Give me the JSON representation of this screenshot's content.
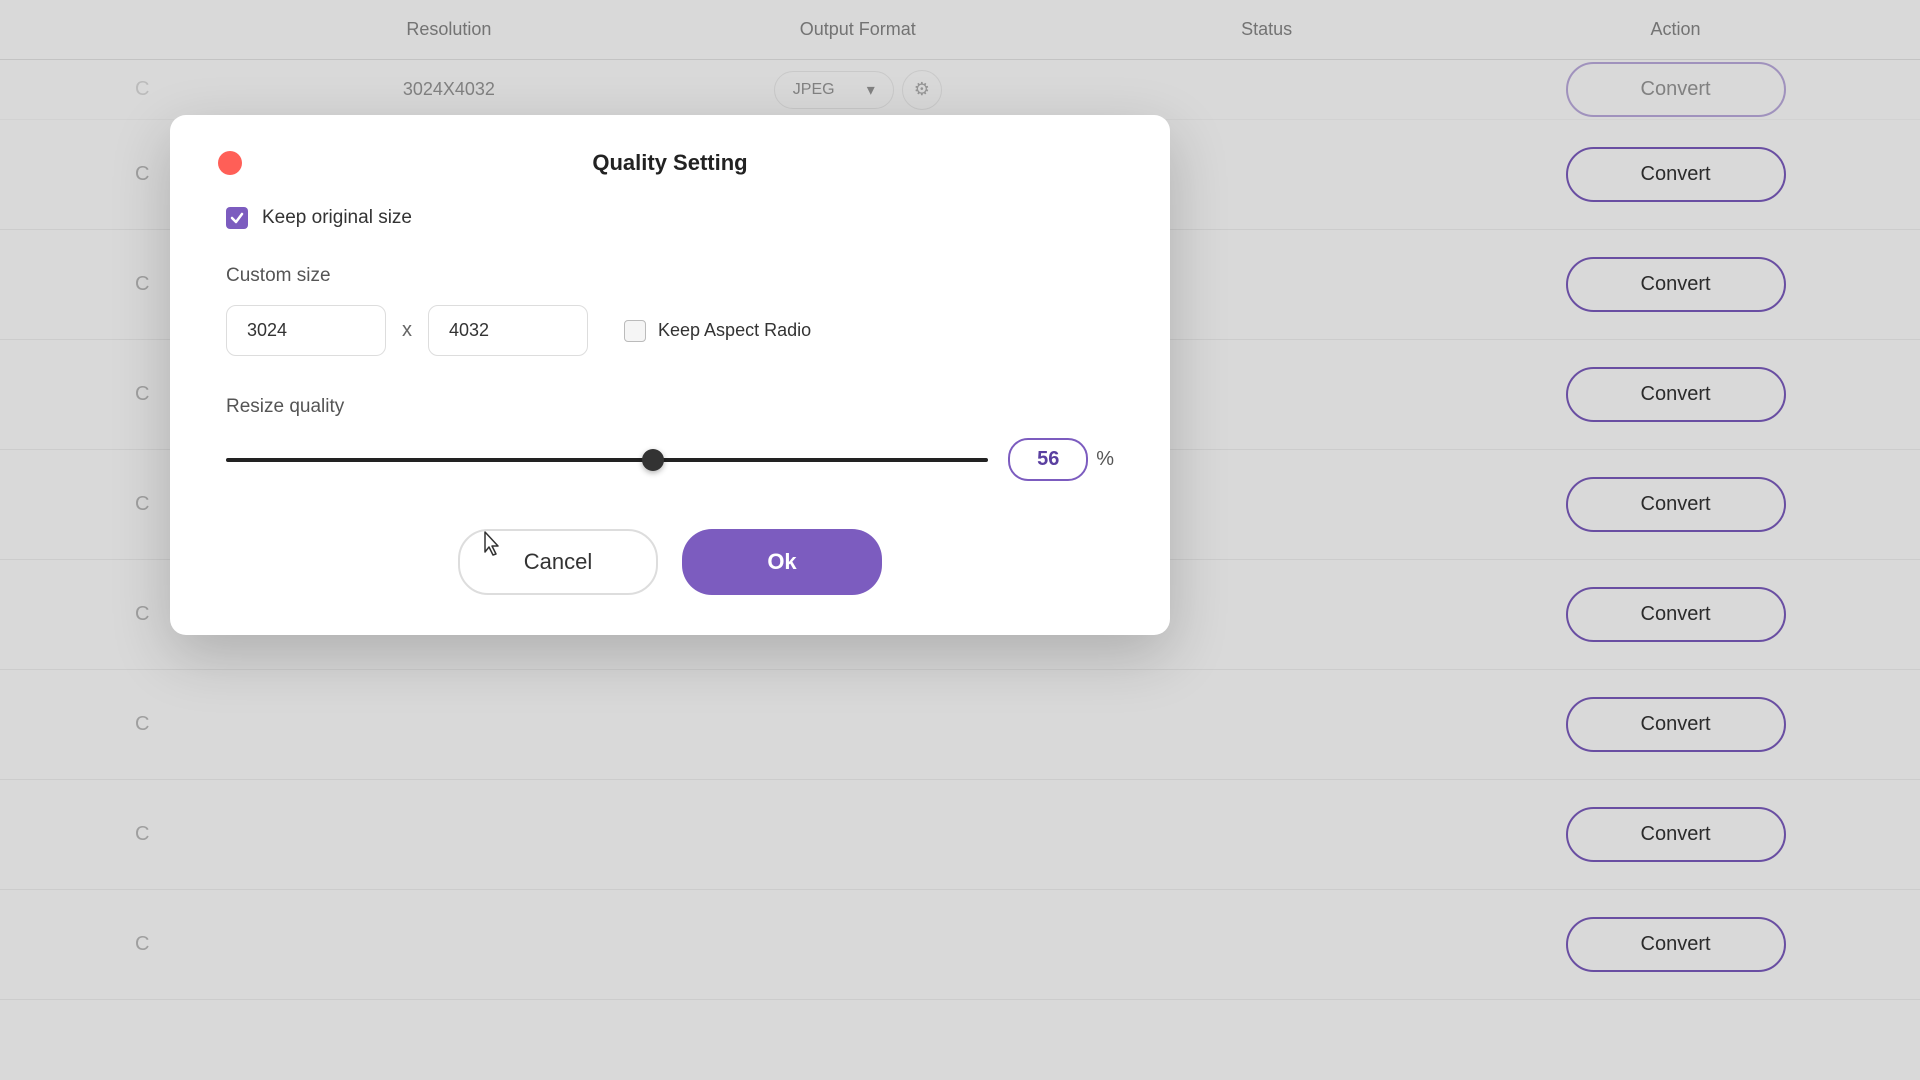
{
  "header": {
    "col1": "Resolution",
    "col2": "Output Format",
    "col3": "Status",
    "col4": "Action"
  },
  "rows": [
    {
      "label": "C",
      "resolution": "3024X4032",
      "format": "JPEG",
      "convert": "Convert"
    },
    {
      "label": "C",
      "resolution": "",
      "format": "",
      "convert": "Convert"
    },
    {
      "label": "C",
      "resolution": "",
      "format": "",
      "convert": "Convert"
    },
    {
      "label": "C",
      "resolution": "",
      "format": "",
      "convert": "Convert"
    },
    {
      "label": "C",
      "resolution": "",
      "format": "",
      "convert": "Convert"
    },
    {
      "label": "C",
      "resolution": "",
      "format": "",
      "convert": "Convert"
    },
    {
      "label": "C",
      "resolution": "",
      "format": "",
      "convert": "Convert"
    },
    {
      "label": "C",
      "resolution": "",
      "format": "",
      "convert": "Convert"
    },
    {
      "label": "C",
      "resolution": "",
      "format": "",
      "convert": "Convert"
    }
  ],
  "dialog": {
    "title": "Quality Setting",
    "keep_original_label": "Keep original size",
    "custom_size_label": "Custom size",
    "width_value": "3024",
    "height_value": "4032",
    "x_separator": "x",
    "keep_aspect_label": "Keep Aspect Radio",
    "resize_quality_label": "Resize quality",
    "quality_value": "56",
    "percent": "%",
    "cancel_label": "Cancel",
    "ok_label": "Ok"
  },
  "colors": {
    "accent": "#7c5cbf",
    "close_btn": "#ff5f57"
  }
}
